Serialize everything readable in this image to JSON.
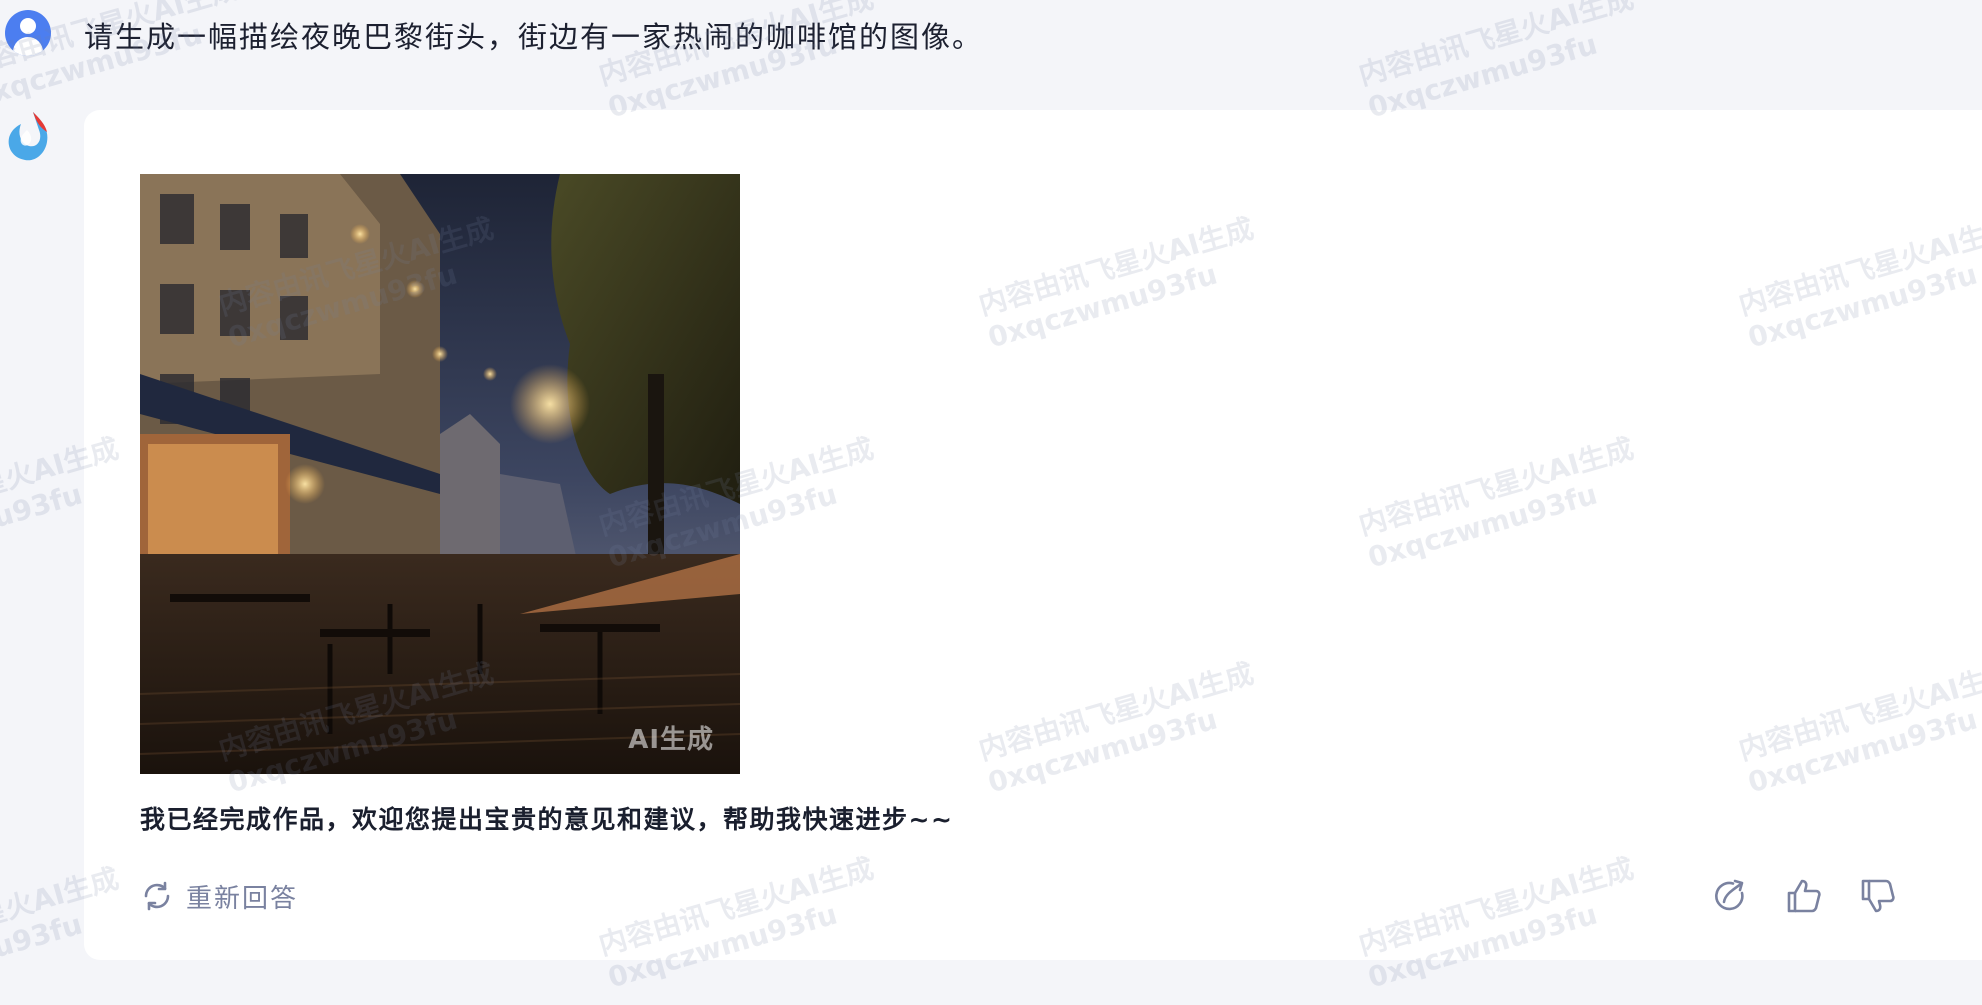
{
  "user_message": "请生成一幅描绘夜晚巴黎街头，街边有一家热闹的咖啡馆的图像。",
  "answer": {
    "image_badge": "AI生成",
    "text": "我已经完成作品，欢迎您提出宝贵的意见和建议，帮助我快速进步~~",
    "regenerate_label": "重新回答"
  },
  "watermark": {
    "line1": "内容由讯飞星火AI生成",
    "line2": "0xqczwmu93fu"
  },
  "colors": {
    "accent_blue": "#4c7ef0",
    "logo_red": "#e53935",
    "muted_gray": "#7a82a0"
  },
  "icons": [
    "user-avatar-icon",
    "spark-logo-icon",
    "refresh-icon",
    "share-icon",
    "thumbs-up-icon",
    "thumbs-down-icon"
  ]
}
